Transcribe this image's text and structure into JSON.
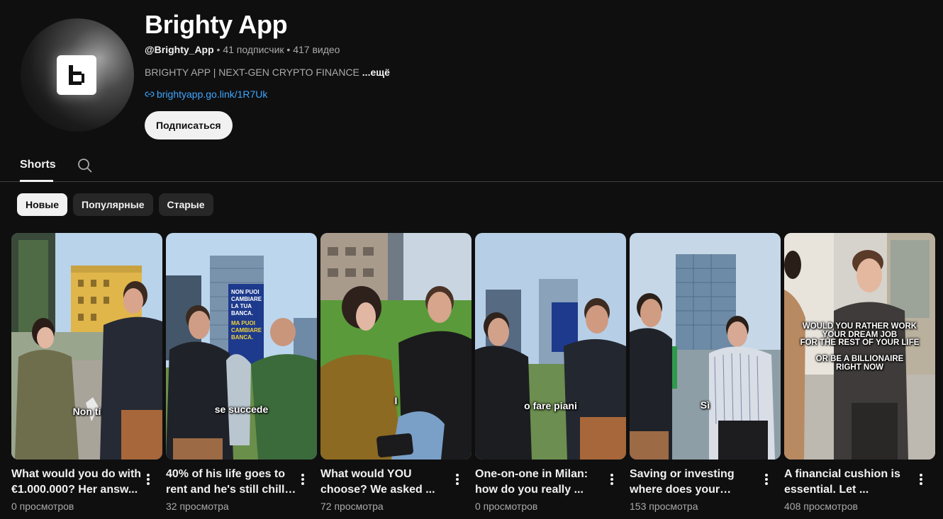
{
  "channel": {
    "name": "Brighty App",
    "handle": "@Brighty_App",
    "subscribers": "41 подписчик",
    "videos": "417 видео",
    "description": "BRIGHTY APP | NEXT-GEN CRYPTO FINANCE",
    "more_label": "...ещё",
    "link": "brightyapp.go.link/1R7Uk",
    "subscribe_label": "Подписаться"
  },
  "tabs": {
    "shorts_label": "Shorts"
  },
  "chips": [
    "Новые",
    "Популярные",
    "Старые"
  ],
  "shorts": [
    {
      "title": "What would you do with €1.000.000? Her answ...",
      "views": "0 просмотров",
      "caption": "Non ti"
    },
    {
      "title": "40% of his life goes to rent and he's still chill ...",
      "views": "32 просмотра",
      "caption": "se succede"
    },
    {
      "title": "What would YOU choose? We asked ...",
      "views": "72 просмотра",
      "caption": "I"
    },
    {
      "title": "One-on-one in Milan: how do you really ...",
      "views": "0 просмотров",
      "caption": "o fare piani"
    },
    {
      "title": "Saving or investing where does your mone...",
      "views": "153 просмотра",
      "caption": "Sì"
    },
    {
      "title": "A financial cushion is essential. Let ...",
      "views": "408 просмотров",
      "caption": "Would you rather work\nyour dream job\nfor the rest of your life\n\nor be a billionaire\nright now"
    }
  ],
  "thumb_texts": {
    "billboard": [
      "NON PUOI",
      "CAMBIARE",
      "LA TUA",
      "BANCA.",
      "MA PUOI",
      "CAMBIARE",
      "BANCA."
    ]
  },
  "colors": {
    "background": "#0f0f0f",
    "link": "#3ea6ff",
    "chip_active": "#f1f1f1",
    "chip": "#272727"
  }
}
